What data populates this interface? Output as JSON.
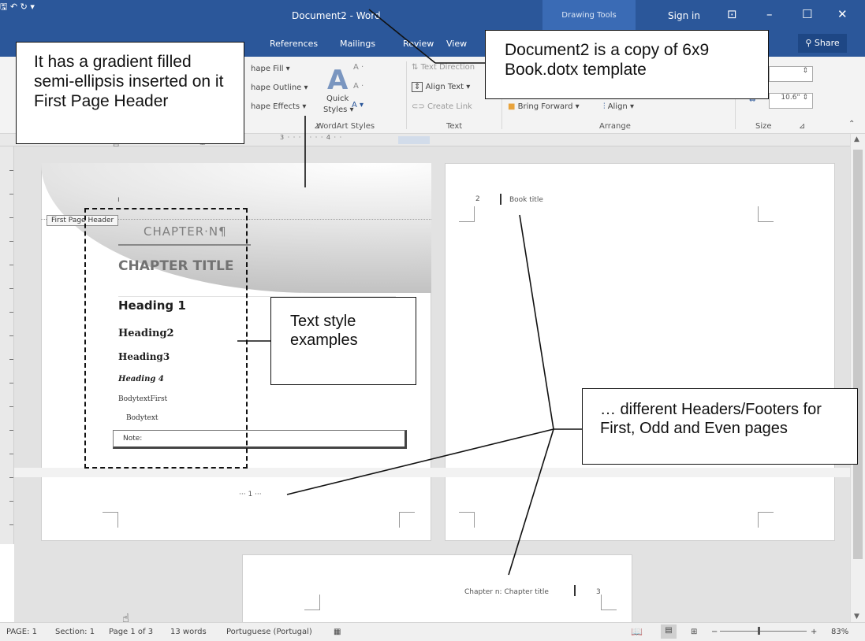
{
  "titlebar": {
    "title": "Document2 - Word",
    "context_tab": "Drawing Tools",
    "sign_in": "Sign in",
    "save_icon": "save-icon",
    "undo_icon": "undo-icon",
    "redo_icon": "redo-icon",
    "customize_icon": "customize-qat-icon",
    "ribbon_display_icon": "ribbon-display-options-icon",
    "minimize_icon": "minimize-icon",
    "maximize_icon": "maximize-icon",
    "close_icon": "close-icon"
  },
  "tabs": [
    "References",
    "Mailings",
    "Review",
    "View"
  ],
  "share": "Share",
  "ribbon": {
    "shape_fill": "hape Fill ▾",
    "shape_outline": "hape Outline ▾",
    "shape_effects": "hape Effects ▾",
    "quick_styles_1": "Quick",
    "quick_styles_2": "Styles ▾",
    "text_direction": "Text Direction",
    "align_text": "Align Text ▾",
    "create_link": "Create Link",
    "bring_forward": "Bring Forward",
    "align": "Align ▾",
    "size_value": "10.6\"",
    "groups": {
      "wordart": "WordArt Styles",
      "text": "Text",
      "arrange": "Arrange",
      "size": "Size"
    }
  },
  "ruler": {
    "marks": "3 · · · ı · · · 4 · ·"
  },
  "page1": {
    "header_tag": "First Page Header",
    "chapter_no": "CHAPTER·N¶",
    "chapter_title": "CHAPTER TITLE",
    "heading1": "Heading 1",
    "heading2": "Heading2",
    "heading3": "Heading3",
    "heading4": "Heading 4",
    "body_first": "BodytextFirst",
    "body": "Bodytext",
    "note": "Note:",
    "footer": "··· 1 ···"
  },
  "page2": {
    "page_num": "2",
    "header_text": "Book title"
  },
  "page3": {
    "header_text": "Chapter n: Chapter title",
    "page_num": "3"
  },
  "callouts": {
    "gradient": "It has a gradient filled semi-ellipsis inserted on it First Page Header",
    "copy": "Document2 is a copy of 6x9 Book.dotx template",
    "styles": "Text style examples",
    "headers": "… different Headers/Footers for First, Odd and Even pages"
  },
  "statusbar": {
    "page": "PAGE: 1",
    "section": "Section: 1",
    "page_of": "Page 1 of 3",
    "words": "13 words",
    "language": "Portuguese (Portugal)",
    "zoom": "83%",
    "zoom_minus": "−",
    "zoom_plus": "+"
  }
}
